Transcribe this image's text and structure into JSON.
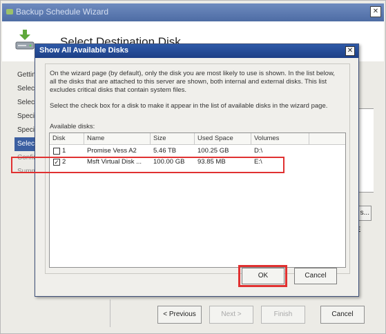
{
  "wizard": {
    "title": "Backup Schedule Wizard",
    "header_title": "Select Destination Disk",
    "nav_items": [
      "Getting",
      "Select",
      "Select",
      "Specif",
      "Specif",
      "Select",
      "Confir",
      "Summ"
    ],
    "side_button_label": "s...",
    "side_letter": "E",
    "buttons": {
      "previous": "< Previous",
      "next": "Next >",
      "finish": "Finish",
      "cancel": "Cancel"
    }
  },
  "dialog": {
    "title": "Show All Available Disks",
    "close_glyph": "✕",
    "intro_text": "On the wizard page (by default), only the disk you are most likely to use is shown. In the list below, all the disks that are attached to this server are shown, both internal and external disks. This list excludes critical disks that contain system files.",
    "instruction_text": "Select the check box for a disk to make it appear in the list of available disks in the wizard page.",
    "available_label": "Available disks:",
    "columns": [
      "Disk",
      "Name",
      "Size",
      "Used Space",
      "Volumes"
    ],
    "rows": [
      {
        "checked": false,
        "disk": "1",
        "name": "Promise Vess A2",
        "size": "5.46 TB",
        "used": "100.25 GB",
        "volumes": "D:\\"
      },
      {
        "checked": true,
        "disk": "2",
        "name": "Msft Virtual Disk ...",
        "size": "100.00 GB",
        "used": "93.85 MB",
        "volumes": "E:\\"
      }
    ],
    "checkmark": "✓",
    "buttons": {
      "ok": "OK",
      "cancel": "Cancel"
    }
  },
  "colors": {
    "highlight": "#e03030",
    "dialog_title": "#1d3f86",
    "selected_nav": "#3b5fa1"
  }
}
